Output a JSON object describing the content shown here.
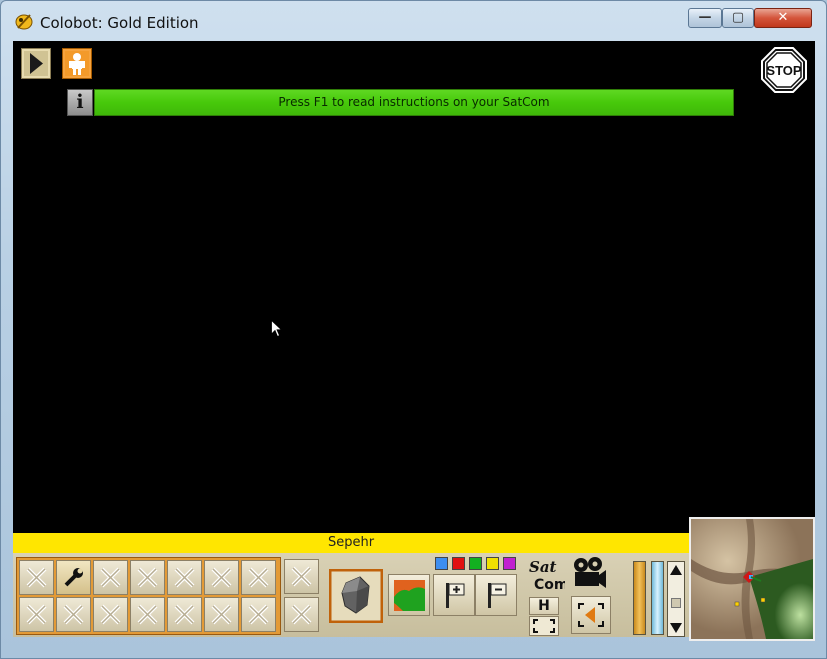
{
  "window": {
    "title": "Colobot: Gold Edition",
    "controls": {
      "minimize": "—",
      "maximize": "▢",
      "close": "✕"
    }
  },
  "hud": {
    "info_icon": "i",
    "info_message": "Press F1 to read instructions on your SatCom",
    "stop_label": "STOP",
    "colors": {
      "info_bar": "#47c90b",
      "name_bar": "#ffe600",
      "stop": "#ffffff"
    }
  },
  "unit": {
    "name": "Sepehr"
  },
  "panel": {
    "satcom_line1": "Sat",
    "satcom_line2": "Com",
    "h_label": "H",
    "flag_colors": [
      "#3d8ef0",
      "#e01010",
      "#12b020",
      "#f0e000",
      "#c020d0"
    ],
    "icons": [
      "play-icon",
      "astronaut-icon",
      "wrench-icon",
      "disabled-slot-icon",
      "titanium-ore-icon",
      "terrain-map-icon",
      "flag-plus-icon",
      "flag-minus-icon",
      "movie-camera-icon",
      "back-arrow-icon",
      "stop-sign-icon"
    ]
  }
}
